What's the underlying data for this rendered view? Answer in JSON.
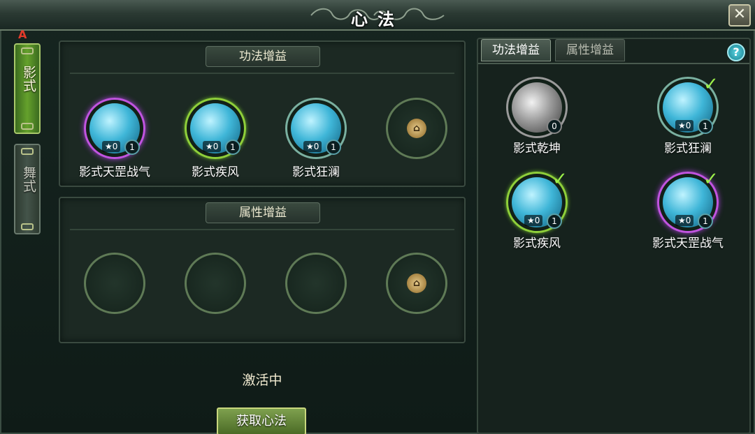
{
  "window": {
    "title": "心法",
    "close_label": "✕"
  },
  "side_tabs": [
    {
      "label": "影式",
      "active": true
    },
    {
      "label": "舞式",
      "active": false
    }
  ],
  "side_badge": "A",
  "skill_panel": {
    "header": "功法增益",
    "slots": [
      {
        "name": "影式天罡战气",
        "stars": "★0",
        "count": "1",
        "ring": "purple",
        "state": "filled"
      },
      {
        "name": "影式疾风",
        "stars": "★0",
        "count": "1",
        "ring": "green",
        "state": "filled"
      },
      {
        "name": "影式狂澜",
        "stars": "★0",
        "count": "1",
        "ring": "teal",
        "state": "filled"
      },
      {
        "name": "",
        "state": "locked"
      }
    ]
  },
  "attr_panel": {
    "header": "属性增益",
    "slots": [
      {
        "state": "empty"
      },
      {
        "state": "empty"
      },
      {
        "state": "empty"
      },
      {
        "state": "locked"
      }
    ]
  },
  "status_text": "激活中",
  "acquire_button": "获取心法",
  "right_panel": {
    "tabs": [
      {
        "label": "功法增益",
        "active": true
      },
      {
        "label": "属性增益",
        "active": false
      }
    ],
    "help_label": "?",
    "items": [
      {
        "name": "影式乾坤",
        "count": "0",
        "stars": "",
        "checked": false,
        "ring": "grey"
      },
      {
        "name": "影式狂澜",
        "count": "1",
        "stars": "★0",
        "checked": true,
        "ring": "teal"
      },
      {
        "name": "影式疾风",
        "count": "1",
        "stars": "★0",
        "checked": true,
        "ring": "green"
      },
      {
        "name": "影式天罡战气",
        "count": "1",
        "stars": "★0",
        "checked": true,
        "ring": "purple"
      }
    ]
  },
  "colors": {
    "accent_green": "#65a12c",
    "purple_ring": "#c154e0",
    "check": "#9cf04a",
    "lock_gold": "#e4c98a"
  }
}
